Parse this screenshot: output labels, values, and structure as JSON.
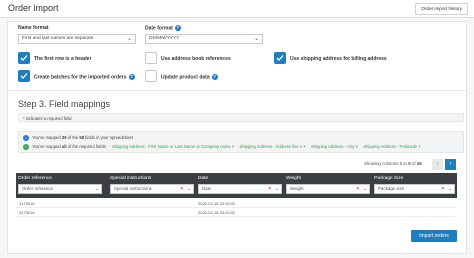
{
  "header": {
    "title": "Order import",
    "history_button": "Order import history"
  },
  "settings": {
    "name_format": {
      "label": "Name format",
      "value": "First and last names are separate"
    },
    "date_format": {
      "label": "Date format",
      "value": "DD/MM/YYYY"
    },
    "checkboxes": [
      {
        "label": "The first row is a header",
        "checked": true
      },
      {
        "label": "Use address book references",
        "checked": false
      },
      {
        "label": "Use shipping address for billing address",
        "checked": true
      },
      {
        "label": "Create batches for the imported orders",
        "checked": true
      },
      {
        "label": "Update product data",
        "checked": false
      }
    ]
  },
  "step3": {
    "title": "Step 3. Field mappings",
    "required_note": "* Indicates a required field",
    "mapped_info": {
      "prefix": "You've mapped",
      "mapped_count": "39",
      "middle": "of the",
      "total": "58",
      "suffix": "fields in your spreadsheet"
    },
    "required_info": {
      "prefix": "You've mapped",
      "emph": "all",
      "suffix": "of the required fields:",
      "fields": [
        "Shipping Address - First Name or Last Name or Company name",
        "Shipping Address - Address line 1",
        "Shipping Address - City",
        "Shipping Address - Postcode"
      ]
    },
    "showing": {
      "prefix": "Showing columns",
      "start": "1",
      "end": "5",
      "of": "of",
      "total": "58"
    },
    "prev_icon": "chevron-left-icon",
    "next_icon": "chevron-right-icon"
  },
  "grid": {
    "columns": [
      {
        "title": "Order reference",
        "mapping": "Order reference",
        "clearable": false
      },
      {
        "title": "Special instructions",
        "mapping": "Special instructions",
        "clearable": true
      },
      {
        "title": "Date",
        "mapping": "Date",
        "clearable": true
      },
      {
        "title": "Weight",
        "mapping": "Weight",
        "clearable": true
      },
      {
        "title": "Package Size",
        "mapping": "Package size",
        "clearable": true
      }
    ],
    "rows": [
      {
        "order_ref": "3175016",
        "date": "2020-02-18 23:15:02"
      },
      {
        "order_ref": "3175016",
        "date": "2020-02-18 23:15:02"
      }
    ]
  },
  "footer": {
    "import_button": "Import orders"
  },
  "colors": {
    "accent": "#1d7fbf",
    "header_dark": "#3b3f44",
    "success": "#3aa24b",
    "danger": "#d33333"
  }
}
